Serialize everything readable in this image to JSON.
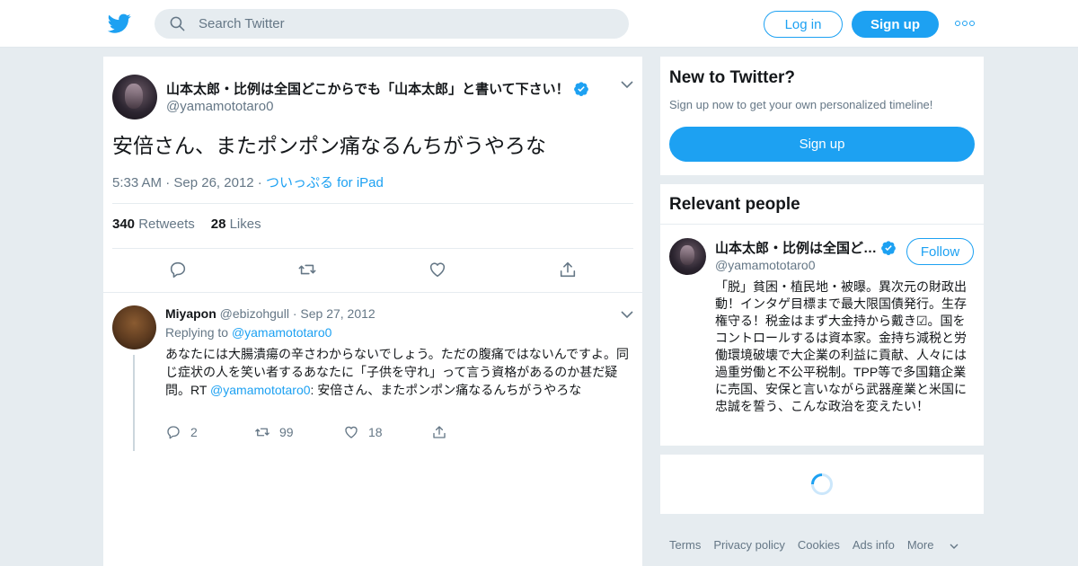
{
  "header": {
    "search_placeholder": "Search Twitter",
    "login_label": "Log in",
    "signup_label": "Sign up",
    "more_icon": "more-dots-icon",
    "logo_icon": "twitter-bird-icon"
  },
  "tweet": {
    "author_name": "山本太郎・比例は全国どこからでも「山本太郎」と書いて下さい！",
    "author_handle": "@yamamototaro0",
    "text": "安倍さん、またポンポン痛なるんちがうやろな",
    "time": "5:33 AM",
    "date": "Sep 26, 2012",
    "source": "ついっぷる for iPad",
    "retweets_count": "340",
    "retweets_label": "Retweets",
    "likes_count": "28",
    "likes_label": "Likes"
  },
  "reply": {
    "name": "Miyapon",
    "handle": "@ebizohgull",
    "date": "Sep 27, 2012",
    "replying_prefix": "Replying to",
    "replying_to": "@yamamototaro0",
    "text_before": "あなたには大腸潰瘍の辛さわからないでしょう。ただの腹痛ではないんですよ。同じ症状の人を笑い者するあなたに「子供を守れ」って言う資格があるのか甚だ疑問。RT ",
    "text_mention": "@yamamototaro0",
    "text_after": ": 安倍さん、またポンポン痛なるんちがうやろな",
    "reply_count": "2",
    "retweet_count": "99",
    "like_count": "18"
  },
  "sidebar": {
    "new_title": "New to Twitter?",
    "new_subtitle": "Sign up now to get your own personalized timeline!",
    "new_signup": "Sign up",
    "relevant_title": "Relevant people",
    "person_name": "山本太郎・比例は全国ど…",
    "person_handle": "@yamamototaro0",
    "follow_label": "Follow",
    "person_bio": "「脱」貧困・植民地・被曝。異次元の財政出動！インタゲ目標まで最大限国債発行。生存権守る！税金はまず大金持から戴き☑。国をコントロールするは資本家。金持ち減税と労働環境破壊で大企業の利益に貢献、人々には過重労働と不公平税制。TPP等で多国籍企業に売国、安保と言いながら武器産業と米国に忠誠を誓う、こんな政治を変えたい！"
  },
  "footer": {
    "terms": "Terms",
    "privacy": "Privacy policy",
    "cookies": "Cookies",
    "ads": "Ads info",
    "more": "More"
  },
  "colors": {
    "accent": "#1da1f2",
    "background": "#e6ecf0",
    "text_secondary": "#657786"
  }
}
